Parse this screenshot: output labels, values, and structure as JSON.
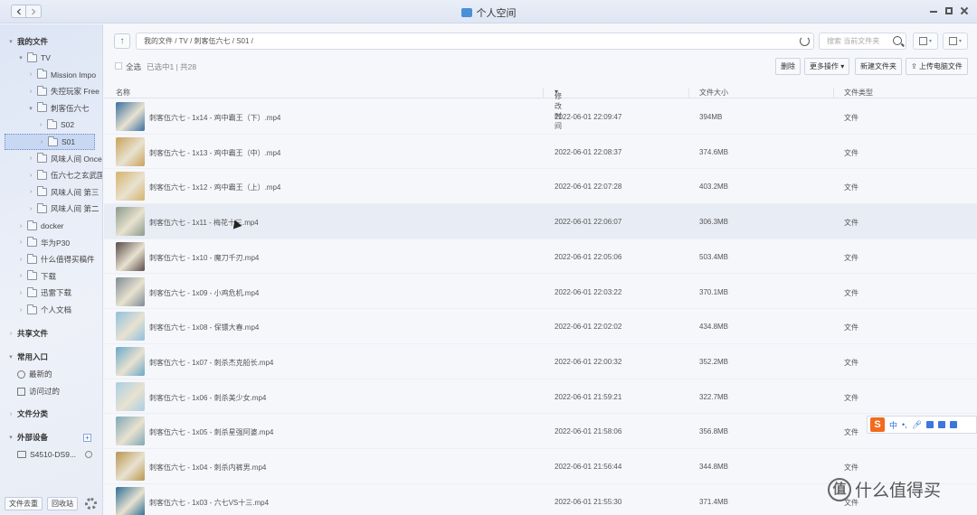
{
  "window": {
    "title": "个人空间"
  },
  "sidebar": {
    "my_files_label": "我的文件",
    "tree": [
      {
        "label": "TV",
        "level": 1,
        "expanded": true
      },
      {
        "label": "Mission Impo",
        "level": 2
      },
      {
        "label": "失控玩家 Free",
        "level": 2
      },
      {
        "label": "刺客伍六七",
        "level": 2,
        "expanded": true
      },
      {
        "label": "S02",
        "level": 3
      },
      {
        "label": "S01",
        "level": 3,
        "selected": true
      },
      {
        "label": "风味人间 Once",
        "level": 2
      },
      {
        "label": "伍六七之玄武国",
        "level": 2
      },
      {
        "label": "风味人间 第三",
        "level": 2
      },
      {
        "label": "风味人间 第二",
        "level": 2
      },
      {
        "label": "docker",
        "level": 1
      },
      {
        "label": "华为P30",
        "level": 1
      },
      {
        "label": "什么值得买稿件",
        "level": 1
      },
      {
        "label": "下载",
        "level": 1
      },
      {
        "label": "迅雷下载",
        "level": 1
      },
      {
        "label": "个人文档",
        "level": 1
      }
    ],
    "shared_label": "共享文件",
    "common_label": "常用入口",
    "recent_label": "最新的",
    "visited_label": "访问过的",
    "category_label": "文件分类",
    "external_label": "外部设备",
    "device_label": "S4510-DS9...",
    "bottom": {
      "file_manager": "文件去重",
      "recycle": "回收站"
    }
  },
  "main": {
    "path": "我的文件 / TV / 刺客伍六七 / S01 /",
    "search_placeholder": "搜索 当前文件夹",
    "select_all": "全选",
    "selection_info": "已选中1 | 共28",
    "buttons": {
      "delete": "删除",
      "more": "更多操作",
      "new_folder": "新建文件夹",
      "upload": "上传电脑文件"
    },
    "columns": {
      "name": "名称",
      "mtime": "修改时间",
      "size": "文件大小",
      "type": "文件类型"
    },
    "rows": [
      {
        "name": "刺客伍六七 - 1x14 - 鸡中霸王（下）.mp4",
        "time": "2022-06-01 22:09:47",
        "size": "394MB",
        "type": "文件",
        "thumb": "#3a6fa0"
      },
      {
        "name": "刺客伍六七 - 1x13 - 鸡中霸王（中）.mp4",
        "time": "2022-06-01 22:08:37",
        "size": "374.6MB",
        "type": "文件",
        "thumb": "#c9a25a"
      },
      {
        "name": "刺客伍六七 - 1x12 - 鸡中霸王（上）.mp4",
        "time": "2022-06-01 22:07:28",
        "size": "403.2MB",
        "type": "文件",
        "thumb": "#d5b36a"
      },
      {
        "name": "刺客伍六七 - 1x11 - 梅花十三.mp4",
        "time": "2022-06-01 22:06:07",
        "size": "306.3MB",
        "type": "文件",
        "thumb": "#8a9a8a"
      },
      {
        "name": "刺客伍六七 - 1x10 - 魔刀千刃.mp4",
        "time": "2022-06-01 22:05:06",
        "size": "503.4MB",
        "type": "文件",
        "thumb": "#5a4a4a"
      },
      {
        "name": "刺客伍六七 - 1x09 - 小鸡危机.mp4",
        "time": "2022-06-01 22:03:22",
        "size": "370.1MB",
        "type": "文件",
        "thumb": "#7f8a95"
      },
      {
        "name": "刺客伍六七 - 1x08 - 保镖大春.mp4",
        "time": "2022-06-01 22:02:02",
        "size": "434.8MB",
        "type": "文件",
        "thumb": "#8fc0df"
      },
      {
        "name": "刺客伍六七 - 1x07 - 刺杀杰克船长.mp4",
        "time": "2022-06-01 22:00:32",
        "size": "352.2MB",
        "type": "文件",
        "thumb": "#6aa8c9"
      },
      {
        "name": "刺客伍六七 - 1x06 - 刺杀美少女.mp4",
        "time": "2022-06-01 21:59:21",
        "size": "322.7MB",
        "type": "文件",
        "thumb": "#a9cfe4"
      },
      {
        "name": "刺客伍六七 - 1x05 - 刺杀星强阿婆.mp4",
        "time": "2022-06-01 21:58:06",
        "size": "356.8MB",
        "type": "文件",
        "thumb": "#7fa7b5"
      },
      {
        "name": "刺客伍六七 - 1x04 - 刺杀内裤男.mp4",
        "time": "2022-06-01 21:56:44",
        "size": "344.8MB",
        "type": "文件",
        "thumb": "#b9964f"
      },
      {
        "name": "刺客伍六七 - 1x03 - 六七VS十三.mp4",
        "time": "2022-06-01 21:55:30",
        "size": "371.4MB",
        "type": "文件",
        "thumb": "#2d6e95"
      }
    ]
  },
  "ime": {
    "logo": "S",
    "mode": "中"
  },
  "watermark": {
    "logo": "值",
    "text": "什么值得买"
  }
}
